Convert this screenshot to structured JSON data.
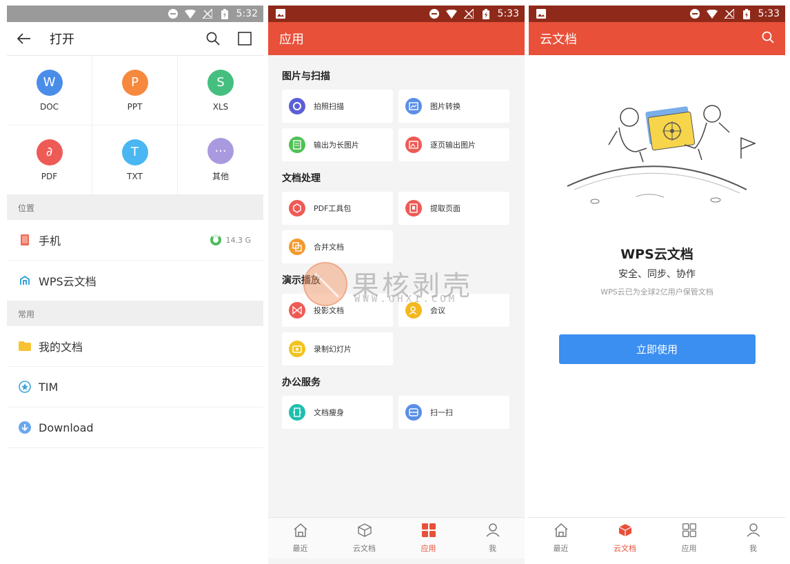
{
  "screen_open": {
    "status": {
      "time": "5:32"
    },
    "header": {
      "title": "打开"
    },
    "file_types": [
      {
        "label": "DOC",
        "glyph": "W",
        "color": "#4a8de8"
      },
      {
        "label": "PPT",
        "glyph": "P",
        "color": "#f6893e"
      },
      {
        "label": "XLS",
        "glyph": "S",
        "color": "#45bf7f"
      },
      {
        "label": "PDF",
        "glyph": "∂",
        "color": "#ee5a55"
      },
      {
        "label": "TXT",
        "glyph": "T",
        "color": "#4ab6f2"
      },
      {
        "label": "其他",
        "glyph": "···",
        "color": "#a99ae0"
      }
    ],
    "location_section": "位置",
    "locations": [
      {
        "label": "手机",
        "meta": "14.3 G",
        "icon": "phone-icon"
      },
      {
        "label": "WPS云文档",
        "icon": "wps-cloud-icon"
      }
    ],
    "common_section": "常用",
    "common": [
      {
        "label": "我的文档",
        "icon": "folder-icon"
      },
      {
        "label": "TIM",
        "icon": "tim-icon"
      },
      {
        "label": "Download",
        "icon": "download-icon"
      }
    ]
  },
  "screen_apps": {
    "status": {
      "time": "5:33"
    },
    "header": {
      "title": "应用"
    },
    "categories": [
      {
        "title": "图片与扫描",
        "items": [
          {
            "label": "拍照扫描",
            "color": "#5b5fd6"
          },
          {
            "label": "图片转换",
            "color": "#5b8fe6"
          },
          {
            "label": "输出为长图片",
            "color": "#4fc154"
          },
          {
            "label": "逐页输出图片",
            "color": "#ee5a55"
          }
        ]
      },
      {
        "title": "文档处理",
        "items": [
          {
            "label": "PDF工具包",
            "color": "#ee5a55"
          },
          {
            "label": "提取页面",
            "color": "#ee5a55"
          },
          {
            "label": "合并文档",
            "color": "#f29a2e"
          }
        ]
      },
      {
        "title": "演示播放",
        "items": [
          {
            "label": "投影文档",
            "color": "#ee5a55"
          },
          {
            "label": "会议",
            "color": "#f2b81e"
          },
          {
            "label": "录制幻灯片",
            "color": "#f2c31e"
          }
        ]
      },
      {
        "title": "办公服务",
        "items": [
          {
            "label": "文档瘦身",
            "color": "#1fbfae"
          },
          {
            "label": "扫一扫",
            "color": "#5b8fe6"
          }
        ]
      }
    ],
    "nav": [
      {
        "label": "最近",
        "icon": "home-icon"
      },
      {
        "label": "云文档",
        "icon": "cube-icon"
      },
      {
        "label": "应用",
        "icon": "apps-grid-icon",
        "active": true
      },
      {
        "label": "我",
        "icon": "person-icon"
      }
    ]
  },
  "screen_cloud": {
    "status": {
      "time": "5:33"
    },
    "header": {
      "title": "云文档"
    },
    "title": "WPS云文档",
    "subtitle": "安全、同步、协作",
    "description": "WPS云已为全球2亿用户保管文档",
    "button": "立即使用",
    "nav": [
      {
        "label": "最近",
        "icon": "home-icon"
      },
      {
        "label": "云文档",
        "icon": "cube-icon",
        "active": true
      },
      {
        "label": "应用",
        "icon": "apps-grid-icon"
      },
      {
        "label": "我",
        "icon": "person-icon"
      }
    ]
  },
  "watermark": {
    "text": "果核剥壳",
    "url": "WWW.GHXI.COM"
  },
  "colors": {
    "accent": "#e8503a",
    "status_dark": "#8f2a1b",
    "button_blue": "#3b8ff0"
  }
}
